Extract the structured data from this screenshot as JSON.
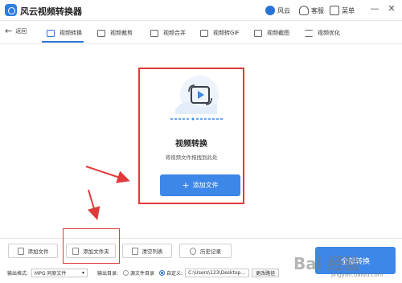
{
  "app": {
    "title": "风云视频转换器"
  },
  "header": {
    "fengyun_label": "风云",
    "service_label": "客服",
    "menu_label": "菜单",
    "minimize": "—",
    "close": "✕"
  },
  "toolbar": {
    "back_label": "返回",
    "tabs": [
      {
        "label": "视频转换",
        "active": true
      },
      {
        "label": "视频裁剪"
      },
      {
        "label": "视频合并"
      },
      {
        "label": "视频转GIF"
      },
      {
        "label": "视频截图"
      },
      {
        "label": "视频优化"
      }
    ]
  },
  "main": {
    "title": "视频转换",
    "hint": "将视频文件拖拽到此处",
    "add_file_plus": "+",
    "add_file_label": "添加文件"
  },
  "bottom": {
    "buttons": [
      {
        "label": "添加文件"
      },
      {
        "label": "添加文件夹"
      },
      {
        "label": "清空列表"
      },
      {
        "label": "历史记录"
      }
    ],
    "output_format_label": "输出格式:",
    "output_format_value": "MPG 同原文件",
    "output_dir_label": "输出目录:",
    "source_dir_option": "源文件目录",
    "custom_option": "自定义:",
    "custom_path": "C:\\Users\\123\\Desktop...",
    "change_path_label": "更改路径",
    "convert_all_label": "全部转换"
  },
  "watermark": {
    "text": "Bai 经验",
    "sub": "jingyan.baidu.com"
  },
  "colors": {
    "accent": "#3d87e8",
    "highlight_red": "#e03a3a"
  }
}
